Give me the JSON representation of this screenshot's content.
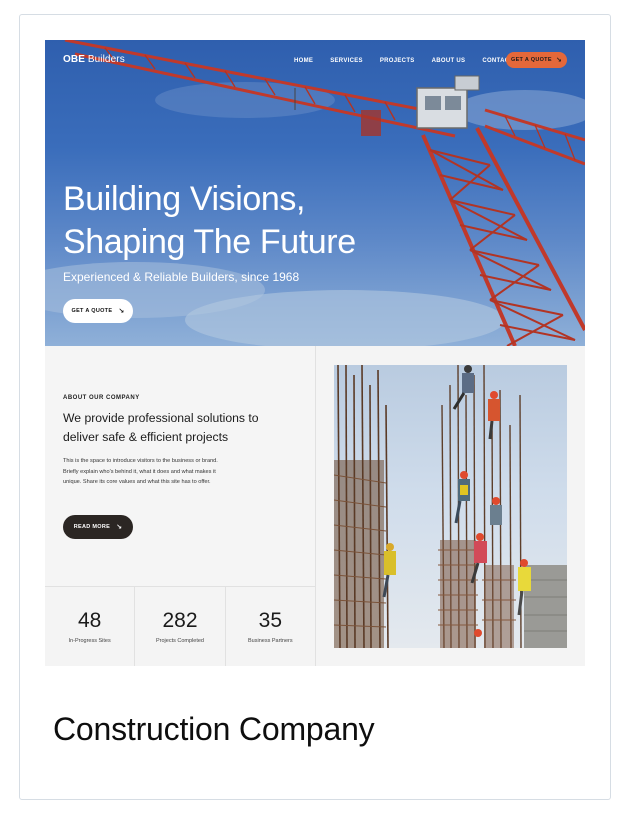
{
  "site": {
    "brand": {
      "bold": "OBE",
      "rest": " Builders"
    },
    "nav": [
      "HOME",
      "SERVICES",
      "PROJECTS",
      "ABOUT US",
      "CONTACT US"
    ],
    "nav_cta": "GET A QUOTE",
    "hero": {
      "title_line1": "Building Visions,",
      "title_line2": "Shaping The Future",
      "subtitle": "Experienced & Reliable Builders, since 1968",
      "cta": "GET A QUOTE"
    },
    "about": {
      "eyebrow": "ABOUT OUR COMPANY",
      "heading": "We provide professional solutions to deliver safe & efficient projects",
      "body": "This is the space to introduce visitors to the business or brand. Briefly explain who's behind it, what it does and what makes it unique. Share its core values and what this site has to offer.",
      "cta": "READ MORE"
    },
    "stats": [
      {
        "value": "48",
        "label": "In-Progress Sites"
      },
      {
        "value": "282",
        "label": "Projects Completed"
      },
      {
        "value": "35",
        "label": "Business Partners"
      }
    ]
  },
  "caption": "Construction Company",
  "icons": {
    "cta_arrow": "arrow-down-right-icon"
  },
  "colors": {
    "accent": "#e4683a",
    "dark_button": "#2b2623",
    "crane": "#c0392b",
    "sky": "#3a6dbb"
  }
}
